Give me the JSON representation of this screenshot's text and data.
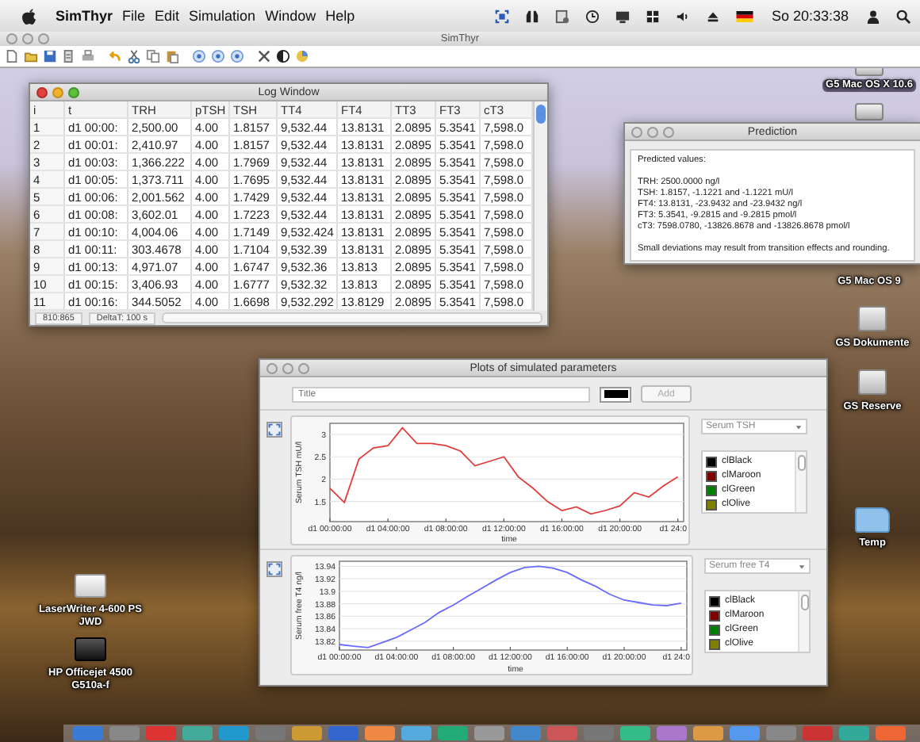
{
  "menu_bar": {
    "app": "SimThyr",
    "items": [
      "File",
      "Edit",
      "Simulation",
      "Window",
      "Help"
    ],
    "clock": "So 20:33:38"
  },
  "app_window": {
    "title": "SimThyr"
  },
  "desktop_items": [
    {
      "kind": "drive",
      "label_lines": [
        "G5 Mac OS X 10.6"
      ]
    },
    {
      "kind": "drive",
      "label_lines": [
        "G5 Mac OS 9"
      ]
    },
    {
      "kind": "drive",
      "label_lines": [
        "GS Dokumente"
      ]
    },
    {
      "kind": "drive",
      "label_lines": [
        "GS Reserve"
      ]
    },
    {
      "kind": "folder",
      "label_lines": [
        "Temp"
      ]
    },
    {
      "kind": "printer",
      "label_lines": [
        "LaserWriter 4-600 PS",
        "JWD"
      ]
    },
    {
      "kind": "printer",
      "label_lines": [
        "HP Officejet 4500",
        "G510a-f"
      ]
    }
  ],
  "log_window": {
    "title": "Log Window",
    "active": true,
    "columns": [
      "i",
      "t",
      "TRH",
      "pTSH",
      "TSH",
      "TT4",
      "FT4",
      "TT3",
      "FT3",
      "cT3"
    ],
    "rows": [
      [
        "1",
        "d1 00:00:",
        "2,500.00",
        "4.00",
        "1.8157",
        "9,532.44",
        "13.8131",
        "2.0895",
        "5.3541",
        "7,598.0"
      ],
      [
        "2",
        "d1 00:01:",
        "2,410.97",
        "4.00",
        "1.8157",
        "9,532.44",
        "13.8131",
        "2.0895",
        "5.3541",
        "7,598.0"
      ],
      [
        "3",
        "d1 00:03:",
        "1,366.222",
        "4.00",
        "1.7969",
        "9,532.44",
        "13.8131",
        "2.0895",
        "5.3541",
        "7,598.0"
      ],
      [
        "4",
        "d1 00:05:",
        "1,373.711",
        "4.00",
        "1.7695",
        "9,532.44",
        "13.8131",
        "2.0895",
        "5.3541",
        "7,598.0"
      ],
      [
        "5",
        "d1 00:06:",
        "2,001.562",
        "4.00",
        "1.7429",
        "9,532.44",
        "13.8131",
        "2.0895",
        "5.3541",
        "7,598.0"
      ],
      [
        "6",
        "d1 00:08:",
        "3,602.01",
        "4.00",
        "1.7223",
        "9,532.44",
        "13.8131",
        "2.0895",
        "5.3541",
        "7,598.0"
      ],
      [
        "7",
        "d1 00:10:",
        "4,004.06",
        "4.00",
        "1.7149",
        "9,532.424",
        "13.8131",
        "2.0895",
        "5.3541",
        "7,598.0"
      ],
      [
        "8",
        "d1 00:11:",
        "303.4678",
        "4.00",
        "1.7104",
        "9,532.39",
        "13.8131",
        "2.0895",
        "5.3541",
        "7,598.0"
      ],
      [
        "9",
        "d1 00:13:",
        "4,971.07",
        "4.00",
        "1.6747",
        "9,532.36",
        "13.813",
        "2.0895",
        "5.3541",
        "7,598.0"
      ],
      [
        "10",
        "d1 00:15:",
        "3,406.93",
        "4.00",
        "1.6777",
        "9,532.32",
        "13.813",
        "2.0895",
        "5.3541",
        "7,598.0"
      ],
      [
        "11",
        "d1 00:16:",
        "344.5052",
        "4.00",
        "1.6698",
        "9,532.292",
        "13.8129",
        "2.0895",
        "5.3541",
        "7,598.0"
      ]
    ],
    "status": [
      "810:865",
      "DeltaT: 100 s"
    ]
  },
  "prediction_window": {
    "title": "Prediction",
    "active": false,
    "heading": "Predicted values:",
    "values": [
      "TRH: 2500.0000 ng/l",
      "TSH: 1.8157, -1.1221 and -1.1221 mU/l",
      "FT4: 13.8131, -23.9432 and -23.9432 ng/l",
      "FT3: 5.3541, -9.2815 and -9.2815 pmol/l",
      "cT3: 7598.0780, -13826.8678 and -13826.8678 pmol/l"
    ],
    "note": "Small deviations may result from transition effects and rounding."
  },
  "plots_window": {
    "title": "Plots of simulated parameters",
    "active": false,
    "title_field": {
      "placeholder": "Title"
    },
    "add_button": {
      "label": "Add",
      "disabled": true
    },
    "panels": [
      {
        "parameter": "Serum TSH",
        "colors": [
          {
            "name": "clBlack",
            "color": "#000000"
          },
          {
            "name": "clMaroon",
            "color": "#800000"
          },
          {
            "name": "clGreen",
            "color": "#008000"
          },
          {
            "name": "clOlive",
            "color": "#808000"
          }
        ],
        "chart_data": {
          "type": "line",
          "xlabel": "time",
          "ylabel": "Serum TSH  mU/l",
          "categories": [
            "d1 00:00:00",
            null,
            null,
            null,
            "d1 04:00:00",
            null,
            null,
            null,
            "d1 08:00:00",
            null,
            null,
            null,
            "d1 12:00:00",
            null,
            null,
            null,
            "d1 16:00:00",
            null,
            null,
            null,
            "d1 20:00:00",
            null,
            null,
            null,
            "d1 24:0"
          ],
          "series": [
            {
              "color": "#e03c3c",
              "values": [
                1.8,
                1.48,
                2.45,
                2.7,
                2.75,
                3.15,
                2.8,
                2.8,
                2.75,
                2.63,
                2.3,
                2.4,
                2.5,
                2.05,
                1.8,
                1.5,
                1.3,
                1.38,
                1.22,
                1.3,
                1.4,
                1.7,
                1.6,
                1.85,
                2.05
              ]
            }
          ],
          "ylim": [
            1.05,
            3.25
          ],
          "grid": true,
          "yticks": [
            1.5,
            2,
            2.5,
            3
          ]
        }
      },
      {
        "parameter": "Serum free T4",
        "colors": [
          {
            "name": "clBlack",
            "color": "#000000"
          },
          {
            "name": "clMaroon",
            "color": "#800000"
          },
          {
            "name": "clGreen",
            "color": "#008000"
          },
          {
            "name": "clOlive",
            "color": "#808000"
          }
        ],
        "chart_data": {
          "type": "line",
          "xlabel": "time",
          "ylabel": "Serum free T4  ng/l",
          "categories": [
            "d1 00:00:00",
            null,
            null,
            null,
            "d1 04:00:00",
            null,
            null,
            null,
            "d1 08:00:00",
            null,
            null,
            null,
            "d1 12:00:00",
            null,
            null,
            null,
            "d1 16:00:00",
            null,
            null,
            null,
            "d1 20:00:00",
            null,
            null,
            null,
            "d1 24:0"
          ],
          "series": [
            {
              "color": "#6a6aff",
              "values": [
                13.815,
                13.812,
                13.81,
                13.818,
                13.826,
                13.838,
                13.85,
                13.866,
                13.878,
                13.892,
                13.905,
                13.918,
                13.93,
                13.938,
                13.94,
                13.937,
                13.93,
                13.918,
                13.908,
                13.895,
                13.886,
                13.882,
                13.878,
                13.877,
                13.881
              ]
            }
          ],
          "ylim": [
            13.806,
            13.948
          ],
          "grid": true,
          "yticks": [
            13.82,
            13.84,
            13.86,
            13.88,
            13.9,
            13.92,
            13.94
          ]
        }
      }
    ]
  }
}
